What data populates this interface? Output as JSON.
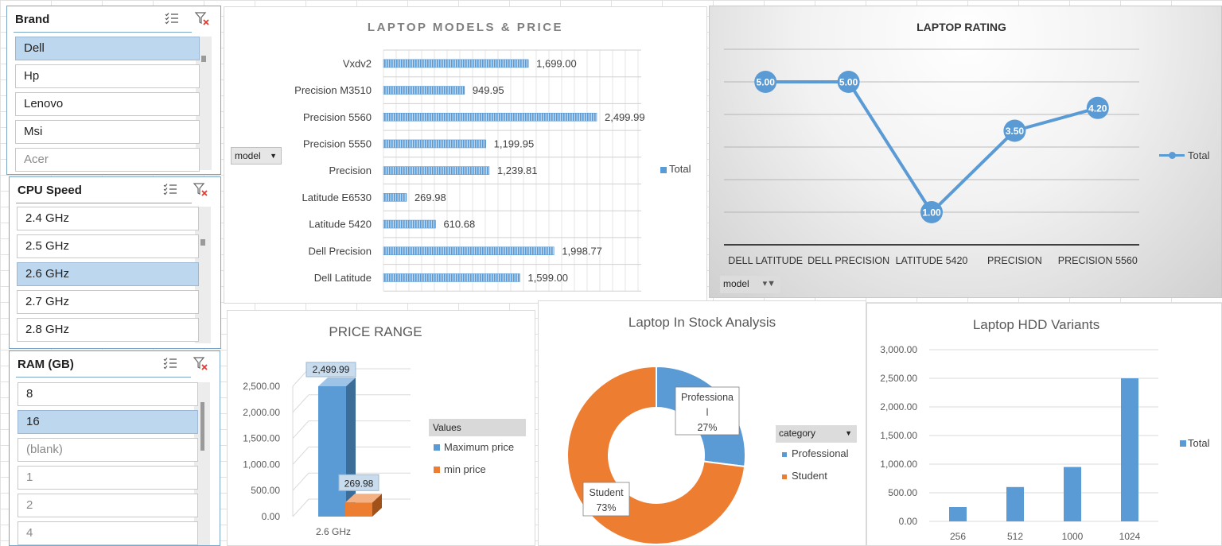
{
  "slicers": {
    "brand": {
      "title": "Brand",
      "items": [
        {
          "label": "Dell",
          "selected": true
        },
        {
          "label": "Hp",
          "selected": false
        },
        {
          "label": "Lenovo",
          "selected": false
        },
        {
          "label": "Msi",
          "selected": false
        },
        {
          "label": "Acer",
          "selected": false,
          "dim": true
        }
      ]
    },
    "cpu": {
      "title": "CPU Speed",
      "items": [
        {
          "label": "2.4 GHz",
          "selected": false
        },
        {
          "label": "2.5 GHz",
          "selected": false
        },
        {
          "label": "2.6 GHz",
          "selected": true
        },
        {
          "label": "2.7 GHz",
          "selected": false
        },
        {
          "label": "2.8 GHz",
          "selected": false
        }
      ]
    },
    "ram": {
      "title": "RAM (GB)",
      "items": [
        {
          "label": "8",
          "selected": false
        },
        {
          "label": "16",
          "selected": true
        },
        {
          "label": "(blank)",
          "selected": false,
          "dim": true
        },
        {
          "label": "1",
          "selected": false,
          "dim": true
        },
        {
          "label": "2",
          "selected": false,
          "dim": true
        },
        {
          "label": "4",
          "selected": false,
          "dim": true
        }
      ]
    }
  },
  "models_chart": {
    "field_button": "model",
    "legend": "Total",
    "chart_data": {
      "type": "bar",
      "title": "LAPTOP MODELS & PRICE",
      "categories": [
        "Vxdv2",
        "Precision M3510",
        "Precision 5560",
        "Precision 5550",
        "Precision",
        "Latitude E6530",
        "Latitude 5420",
        "Dell Precision",
        "Dell Latitude"
      ],
      "values": [
        1699.0,
        949.95,
        2499.99,
        1199.95,
        1239.81,
        269.98,
        610.68,
        1998.77,
        1599.0
      ],
      "value_labels": [
        "1,699.00",
        "949.95",
        "2,499.99",
        "1,199.95",
        "1,239.81",
        "269.98",
        "610.68",
        "1,998.77",
        "1,599.00"
      ],
      "series": [
        {
          "name": "Total"
        }
      ],
      "orientation": "horizontal",
      "xlim": [
        0,
        2500
      ],
      "grid": true,
      "legend_position": "right"
    }
  },
  "rating_chart": {
    "field_button": "model",
    "legend": "Total",
    "chart_data": {
      "type": "line",
      "title": "LAPTOP RATING",
      "categories": [
        "DELL LATITUDE",
        "DELL PRECISION",
        "LATITUDE 5420",
        "PRECISION",
        "PRECISION 5560"
      ],
      "values": [
        5.0,
        5.0,
        1.0,
        3.5,
        4.2
      ],
      "value_labels": [
        "5.00",
        "5.00",
        "1.00",
        "3.50",
        "4.20"
      ],
      "series": [
        {
          "name": "Total"
        }
      ],
      "ylim": [
        0,
        6
      ],
      "grid": true,
      "legend_position": "right"
    }
  },
  "price_range_chart": {
    "legend_title": "Values",
    "chart_data": {
      "type": "bar",
      "title": "PRICE RANGE",
      "categories": [
        "2.6 GHz"
      ],
      "series": [
        {
          "name": "Maximum price",
          "values": [
            2499.99
          ],
          "color": "#5b9bd5"
        },
        {
          "name": "min price",
          "values": [
            269.98
          ],
          "color": "#ed7d31"
        }
      ],
      "value_labels": [
        "2,499.99",
        "269.98"
      ],
      "y_ticks": [
        "0.00",
        "500.00",
        "1,000.00",
        "1,500.00",
        "2,000.00",
        "2,500.00"
      ],
      "ylim": [
        0,
        2500
      ],
      "legend_position": "right"
    }
  },
  "stock_chart": {
    "field_button": "category",
    "chart_data": {
      "type": "pie",
      "title": "Laptop In Stock Analysis",
      "categories": [
        "Professional",
        "Student"
      ],
      "values": [
        27,
        73
      ],
      "labels": [
        [
          "Professiona",
          "l",
          "27%"
        ],
        [
          "Student",
          "73%"
        ]
      ],
      "colors": [
        "#5b9bd5",
        "#ed7d31"
      ],
      "legend_position": "right"
    }
  },
  "hdd_chart": {
    "legend": "Total",
    "chart_data": {
      "type": "bar",
      "title": "Laptop HDD Variants",
      "categories": [
        "256",
        "512",
        "1000",
        "1024"
      ],
      "values": [
        250,
        600,
        950,
        2500
      ],
      "series": [
        {
          "name": "Total"
        }
      ],
      "y_ticks": [
        "0.00",
        "500.00",
        "1,000.00",
        "1,500.00",
        "2,000.00",
        "2,500.00",
        "3,000.00"
      ],
      "ylim": [
        0,
        3000
      ],
      "grid": true,
      "legend_position": "right"
    }
  },
  "colors": {
    "accent_blue": "#5b9bd5",
    "accent_orange": "#ed7d31",
    "selected_item": "#bdd7ee",
    "slicer_border": "#7aa7c7"
  },
  "icons": {
    "multi_select": "multi-select-icon",
    "clear_filter": "clear-filter-icon",
    "dropdown": "dropdown-arrow-icon",
    "filter": "filter-icon"
  }
}
